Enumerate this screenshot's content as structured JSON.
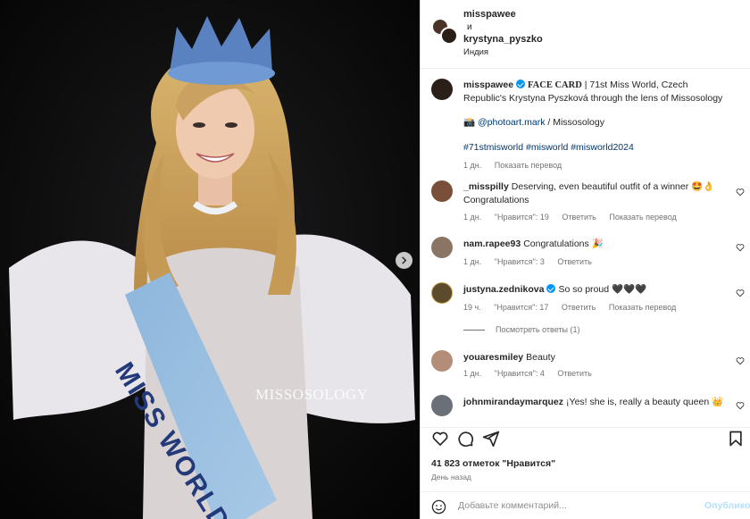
{
  "photo": {
    "sash_text": "MISS WORLD",
    "watermark": "MISSOSOLOGY"
  },
  "header": {
    "user1": "misspawee",
    "conjunction": "и",
    "user2": "krystyna_pyszko",
    "location": "Индия"
  },
  "caption": {
    "username": "misspawee",
    "bold": "FACE CARD",
    "text": " | 71st Miss World, Czech Republic's Krystyna Pyszková through the lens of Missosology",
    "camera_emoji": "📸",
    "mention": "@photoart.mark",
    "credit": " / Missosology",
    "hashtags": "#71stmisworld #misworld #misworld2024",
    "time": "1 дн.",
    "translate": "Показать перевод"
  },
  "comments": [
    {
      "username": "_misspilly",
      "text": "Deserving, even beautiful outfit of a winner 🤩👌 Congratulations",
      "time": "1 дн.",
      "likes": "\"Нравится\": 19",
      "reply": "Ответить",
      "translate": "Показать перевод"
    },
    {
      "username": "nam.rapee93",
      "text": "Congratulations 🎉",
      "time": "1 дн.",
      "likes": "\"Нравится\": 3",
      "reply": "Ответить"
    },
    {
      "username": "justyna.zednikova",
      "text": "So so proud 🖤🖤🖤",
      "time": "19 ч.",
      "likes": "\"Нравится\": 17",
      "reply": "Ответить",
      "translate": "Показать перевод",
      "view_replies": "Посмотреть ответы (1)"
    },
    {
      "username": "youaresmiley",
      "text": "Beauty",
      "time": "1 дн.",
      "likes": "\"Нравится\": 4",
      "reply": "Ответить"
    },
    {
      "username": "johnmirandaymarquez",
      "text": "¡Yes! she is, really a beauty queen 👑"
    }
  ],
  "actions": {
    "likes": "41 823 отметок \"Нравится\"",
    "date": "День назад",
    "comment_placeholder": "Добавьте комментарий...",
    "publish": "Опубликовать"
  },
  "colors": {
    "link": "#00376b",
    "verified": "#0095f6",
    "secondary_text": "#737373"
  }
}
